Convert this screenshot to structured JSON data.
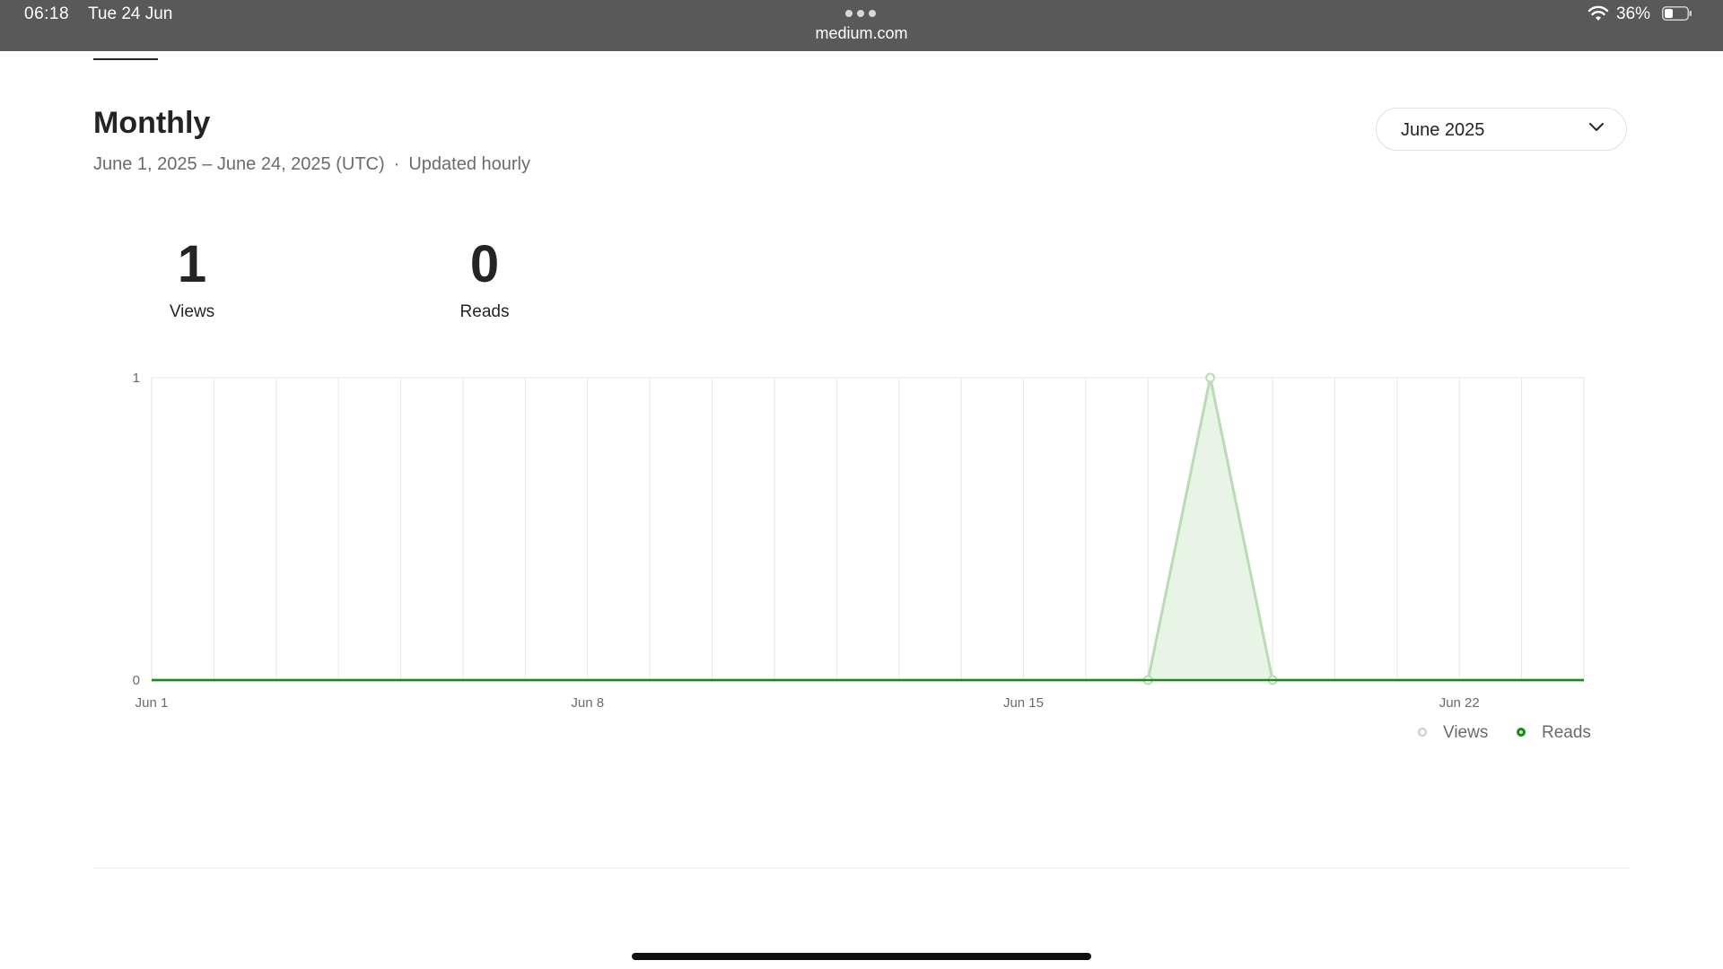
{
  "status_bar": {
    "time": "06:18",
    "date": "Tue 24 Jun",
    "url": "medium.com",
    "battery": "36%",
    "icons": [
      "more-dots-icon",
      "wifi-icon",
      "battery-icon"
    ]
  },
  "header": {
    "title": "Monthly",
    "date_range": "June 1, 2025 – June 24, 2025 (UTC)",
    "separator": "·",
    "update_note": "Updated hourly"
  },
  "month_select": {
    "value": "June 2025",
    "icon": "chevron-down-icon"
  },
  "stats": {
    "views": {
      "value": "1",
      "label": "Views"
    },
    "reads": {
      "value": "0",
      "label": "Reads"
    }
  },
  "colors": {
    "views": "#b9dcb4",
    "views_fill": "#e8f4e6",
    "reads": "#1a8917",
    "grid": "#e6e6e6",
    "text": "#242424",
    "muted": "#6b6b6b"
  },
  "chart_data": {
    "type": "area",
    "x": [
      "Jun 1",
      "Jun 2",
      "Jun 3",
      "Jun 4",
      "Jun 5",
      "Jun 6",
      "Jun 7",
      "Jun 8",
      "Jun 9",
      "Jun 10",
      "Jun 11",
      "Jun 12",
      "Jun 13",
      "Jun 14",
      "Jun 15",
      "Jun 16",
      "Jun 17",
      "Jun 18",
      "Jun 19",
      "Jun 20",
      "Jun 21",
      "Jun 22",
      "Jun 23",
      "Jun 24"
    ],
    "x_tick_labels": [
      "Jun 1",
      "Jun 8",
      "Jun 15",
      "Jun 22"
    ],
    "series": [
      {
        "name": "Views",
        "values": [
          0,
          0,
          0,
          0,
          0,
          0,
          0,
          0,
          0,
          0,
          0,
          0,
          0,
          0,
          0,
          0,
          0,
          1,
          0,
          0,
          0,
          0,
          0,
          0
        ]
      },
      {
        "name": "Reads",
        "values": [
          0,
          0,
          0,
          0,
          0,
          0,
          0,
          0,
          0,
          0,
          0,
          0,
          0,
          0,
          0,
          0,
          0,
          0,
          0,
          0,
          0,
          0,
          0,
          0
        ]
      }
    ],
    "y_ticks": [
      "0",
      "1"
    ],
    "ylim": [
      0,
      1
    ],
    "grid": true,
    "legend": "bottom-right"
  }
}
